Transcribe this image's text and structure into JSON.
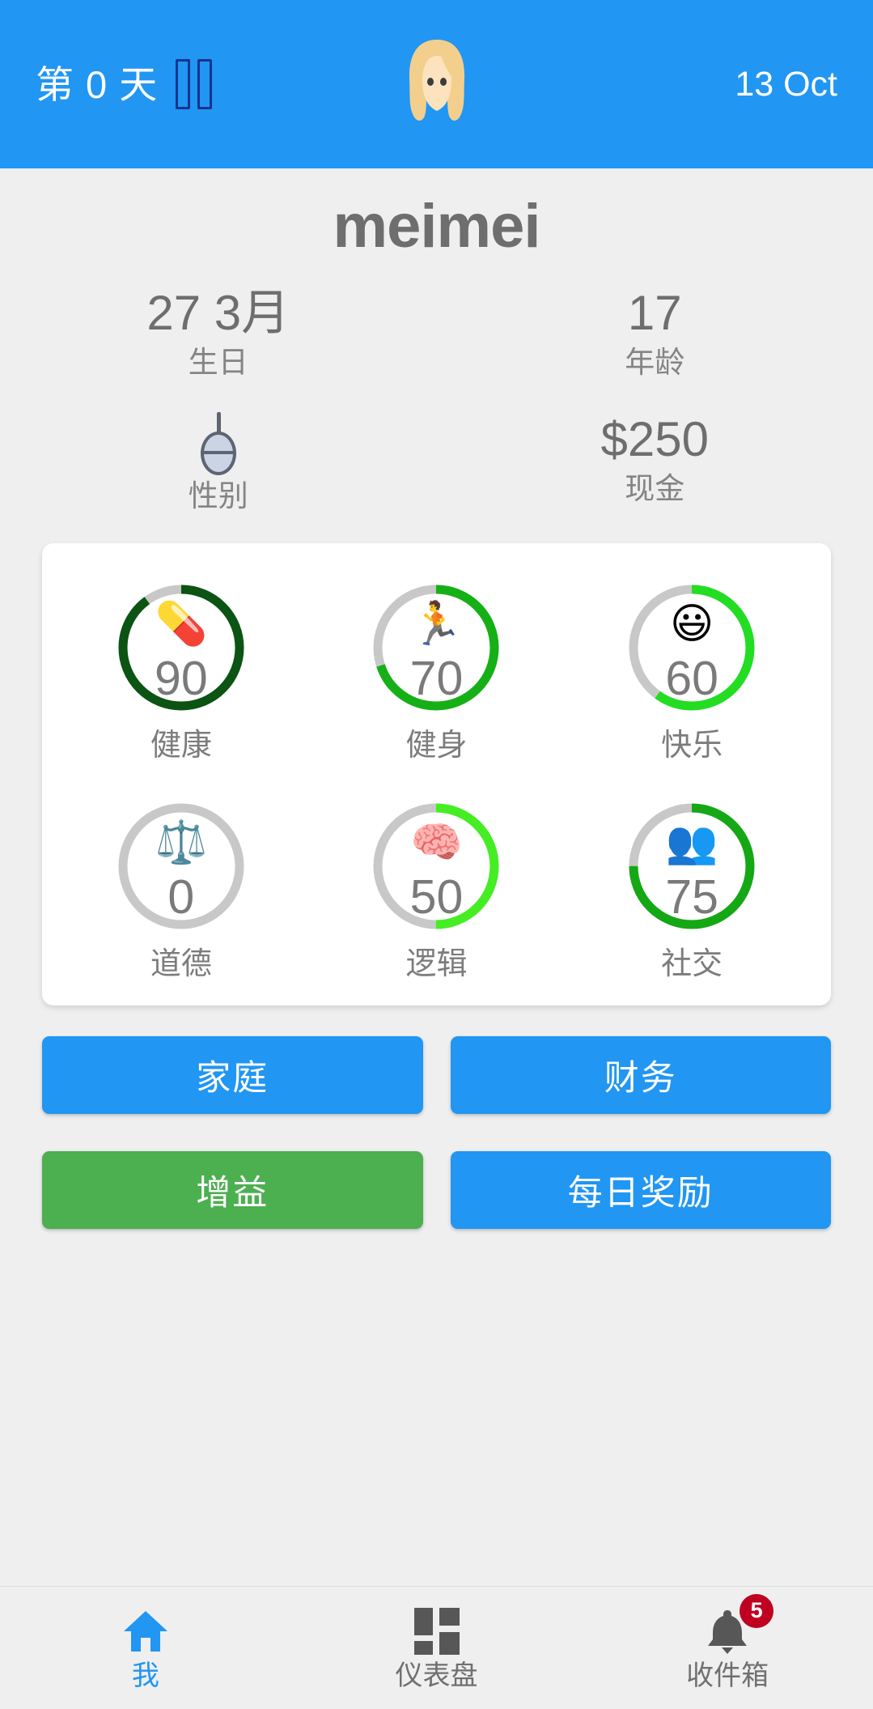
{
  "header": {
    "day_label": "第 0 天",
    "pause_icon": "pause-icon",
    "avatar_icon": "blonde-woman-avatar",
    "date": "13 Oct"
  },
  "profile": {
    "name": "meimei",
    "stats": [
      {
        "value": "27 3月",
        "label": "生日",
        "icon": null
      },
      {
        "value": "17",
        "label": "年龄",
        "icon": null
      },
      {
        "value": "",
        "label": "性别",
        "icon": "female-gender-symbol"
      },
      {
        "value": "$250",
        "label": "现金",
        "icon": null
      }
    ]
  },
  "attributes": {
    "items": [
      {
        "icon": "💊",
        "icon_name": "pill-icon",
        "value": "90",
        "label": "健康",
        "percent": 90,
        "color": "#0b5413"
      },
      {
        "icon": "🏃",
        "icon_name": "runner-icon",
        "value": "70",
        "label": "健身",
        "percent": 70,
        "color": "#15b015"
      },
      {
        "icon": "😃",
        "icon_name": "smiley-icon",
        "value": "60",
        "label": "快乐",
        "percent": 60,
        "color": "#22dd22"
      },
      {
        "icon": "⚖️",
        "icon_name": "scales-icon",
        "value": "0",
        "label": "道德",
        "percent": 0,
        "color": "#c8c8c8"
      },
      {
        "icon": "🧠",
        "icon_name": "brain-icon",
        "value": "50",
        "label": "逻辑",
        "percent": 50,
        "color": "#44ee22"
      },
      {
        "icon": "👥",
        "icon_name": "people-icon",
        "value": "75",
        "label": "社交",
        "percent": 75,
        "color": "#14a814"
      }
    ],
    "track_color": "#c8c8c8"
  },
  "actions": {
    "rows": [
      [
        {
          "label": "家庭",
          "style": "blue"
        },
        {
          "label": "财务",
          "style": "blue"
        }
      ],
      [
        {
          "label": "增益",
          "style": "green"
        },
        {
          "label": "每日奖励",
          "style": "blue"
        }
      ]
    ]
  },
  "nav": {
    "items": [
      {
        "label": "我",
        "icon": "home-icon",
        "active": true,
        "badge": null
      },
      {
        "label": "仪表盘",
        "icon": "dashboard-icon",
        "active": false,
        "badge": null
      },
      {
        "label": "收件箱",
        "icon": "bell-icon",
        "active": false,
        "badge": "5"
      }
    ]
  },
  "colors": {
    "accent": "#2196f3",
    "green": "#4caf50",
    "badge": "#c00020",
    "background": "#efeff0"
  }
}
